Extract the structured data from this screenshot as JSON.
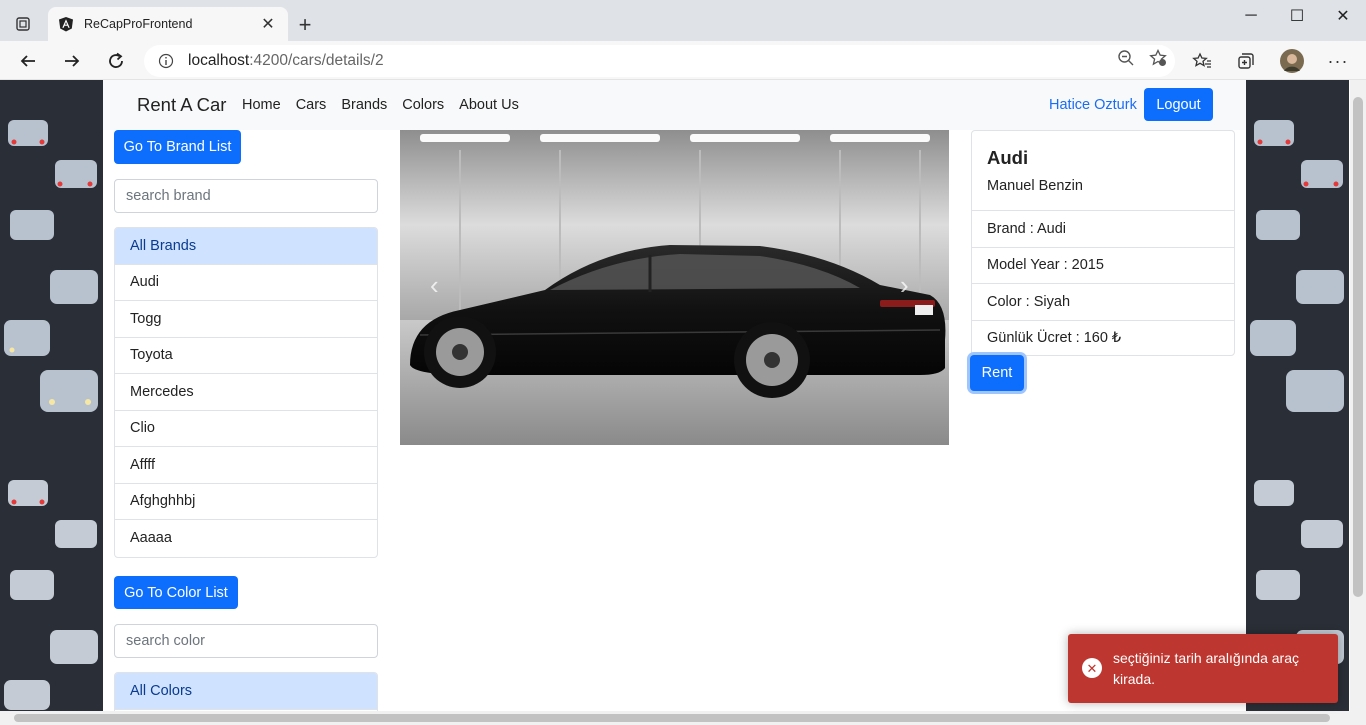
{
  "browser": {
    "tab_title": "ReCapProFrontend",
    "url_host": "localhost",
    "url_path": ":4200/cars/details/2"
  },
  "navbar": {
    "brand": "Rent A Car",
    "links": [
      "Home",
      "Cars",
      "Brands",
      "Colors",
      "About Us"
    ],
    "user": "Hatice Ozturk",
    "logout": "Logout"
  },
  "sidebar": {
    "go_brand_label": "Go To Brand List",
    "brand_search_placeholder": "search brand",
    "brands": [
      "All Brands",
      "Audi",
      "Togg",
      "Toyota",
      "Mercedes",
      "Clio",
      "Affff",
      "Afghghhbj",
      "Aaaaa"
    ],
    "go_color_label": "Go To Color List",
    "color_search_placeholder": "search color",
    "colors": [
      "All Colors"
    ]
  },
  "car": {
    "title": "Audi",
    "subtitle": "Manuel Benzin",
    "rows": [
      "Brand : Audi",
      "Model Year : 2015",
      "Color : Siyah",
      "Günlük Ücret : 160 ₺"
    ],
    "rent_label": "Rent"
  },
  "toast": {
    "message": "seçtiğiniz tarih aralığında araç kirada."
  },
  "colors": {
    "primary": "#0d6efd",
    "toast_error": "#bd362f",
    "active_item": "#cfe2ff"
  }
}
